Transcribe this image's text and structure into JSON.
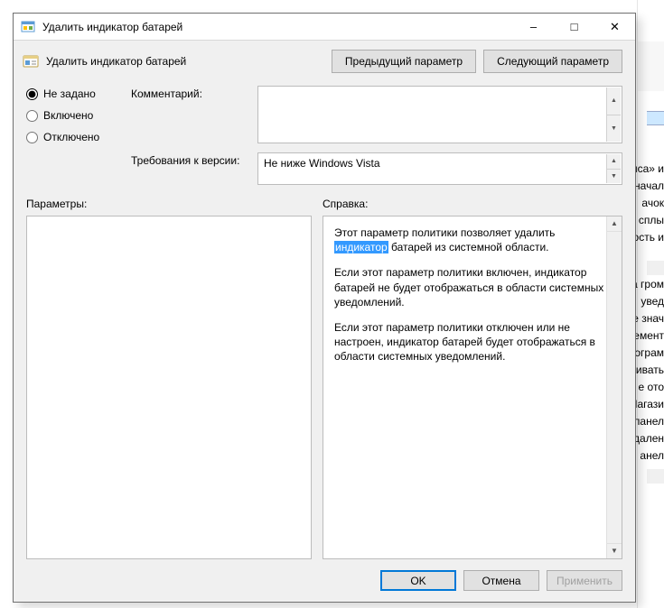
{
  "window": {
    "title": "Удалить индикатор батарей"
  },
  "header": {
    "policy_title": "Удалить индикатор батарей",
    "prev_btn": "Предыдущий параметр",
    "next_btn": "Следующий параметр"
  },
  "state": {
    "not_configured": "Не задано",
    "enabled": "Включено",
    "disabled": "Отключено",
    "selected": "not_configured"
  },
  "labels": {
    "comment": "Комментарий:",
    "version": "Требования к версии:",
    "parameters": "Параметры:",
    "help": "Справка:"
  },
  "fields": {
    "comment_value": "",
    "version_value": "Не ниже Windows Vista"
  },
  "help": {
    "p1_before": "Этот параметр политики позволяет удалить ",
    "p1_highlight": "индикатор",
    "p1_after": " батарей из системной области.",
    "p2": "Если этот параметр политики включен, индикатор батарей не будет отображаться в области системных уведомлений.",
    "p3": "Если этот параметр политики отключен или не настроен, индикатор батарей будет отображаться в области системных уведомлений."
  },
  "footer": {
    "ok": "OK",
    "cancel": "Отмена",
    "apply": "Применить"
  },
  "background": {
    "frag1": "нса» и",
    "frag2": "начал",
    "frag3": "ачок",
    "frag4": "сплы",
    "frag5": "ость и",
    "frag6": "а гром",
    "frag7": "увед",
    "frag8": "е знач",
    "frag9": "емент",
    "frag10": "ограм",
    "frag11": "живать",
    "frag12": "е ото",
    "frag13": "Иагази",
    "frag14": "панел",
    "frag15": "дален",
    "frag16": "анел"
  }
}
